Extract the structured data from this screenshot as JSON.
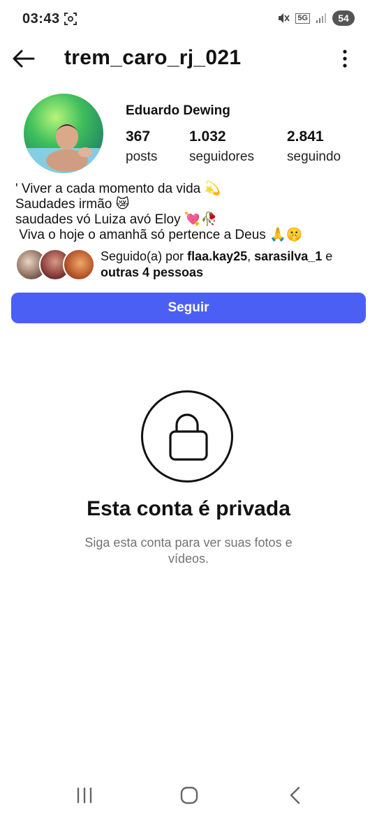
{
  "status_bar": {
    "time": "03:43",
    "network": "5G",
    "battery": "54",
    "icons": [
      "screen-record-icon",
      "mute-icon",
      "network-5g-icon",
      "signal-icon",
      "battery-icon"
    ]
  },
  "header": {
    "username": "trem_caro_rj_021",
    "back_icon": "arrow-left-icon",
    "more_icon": "more-vertical-icon"
  },
  "profile": {
    "full_name": "Eduardo Dewing",
    "stats": [
      {
        "value": "367",
        "label": "posts"
      },
      {
        "value": "1.032",
        "label": "seguidores"
      },
      {
        "value": "2.841",
        "label": "seguindo"
      }
    ],
    "bio": [
      "' Viver a cada momento da vida 💫",
      "Saudades irmão 😿",
      "saudades vó Luiza avó Eloy 💘🥀",
      " Viva o hoje o amanhã só pertence a Deus 🙏🤫"
    ]
  },
  "followed_by": {
    "prefix": "Seguido(a) por ",
    "user1": "flaa.kay25",
    "separator": ", ",
    "user2": "sarasilva_1",
    "conjunction": " e",
    "others": "outras 4 pessoas"
  },
  "follow_button": {
    "label": "Seguir",
    "color": "#4c5ff4"
  },
  "private": {
    "title": "Esta conta é privada",
    "subtitle": "Siga esta conta para ver suas fotos e vídeos."
  },
  "nav_bar": {
    "icons": [
      "recents-icon",
      "home-icon",
      "back-icon"
    ]
  }
}
